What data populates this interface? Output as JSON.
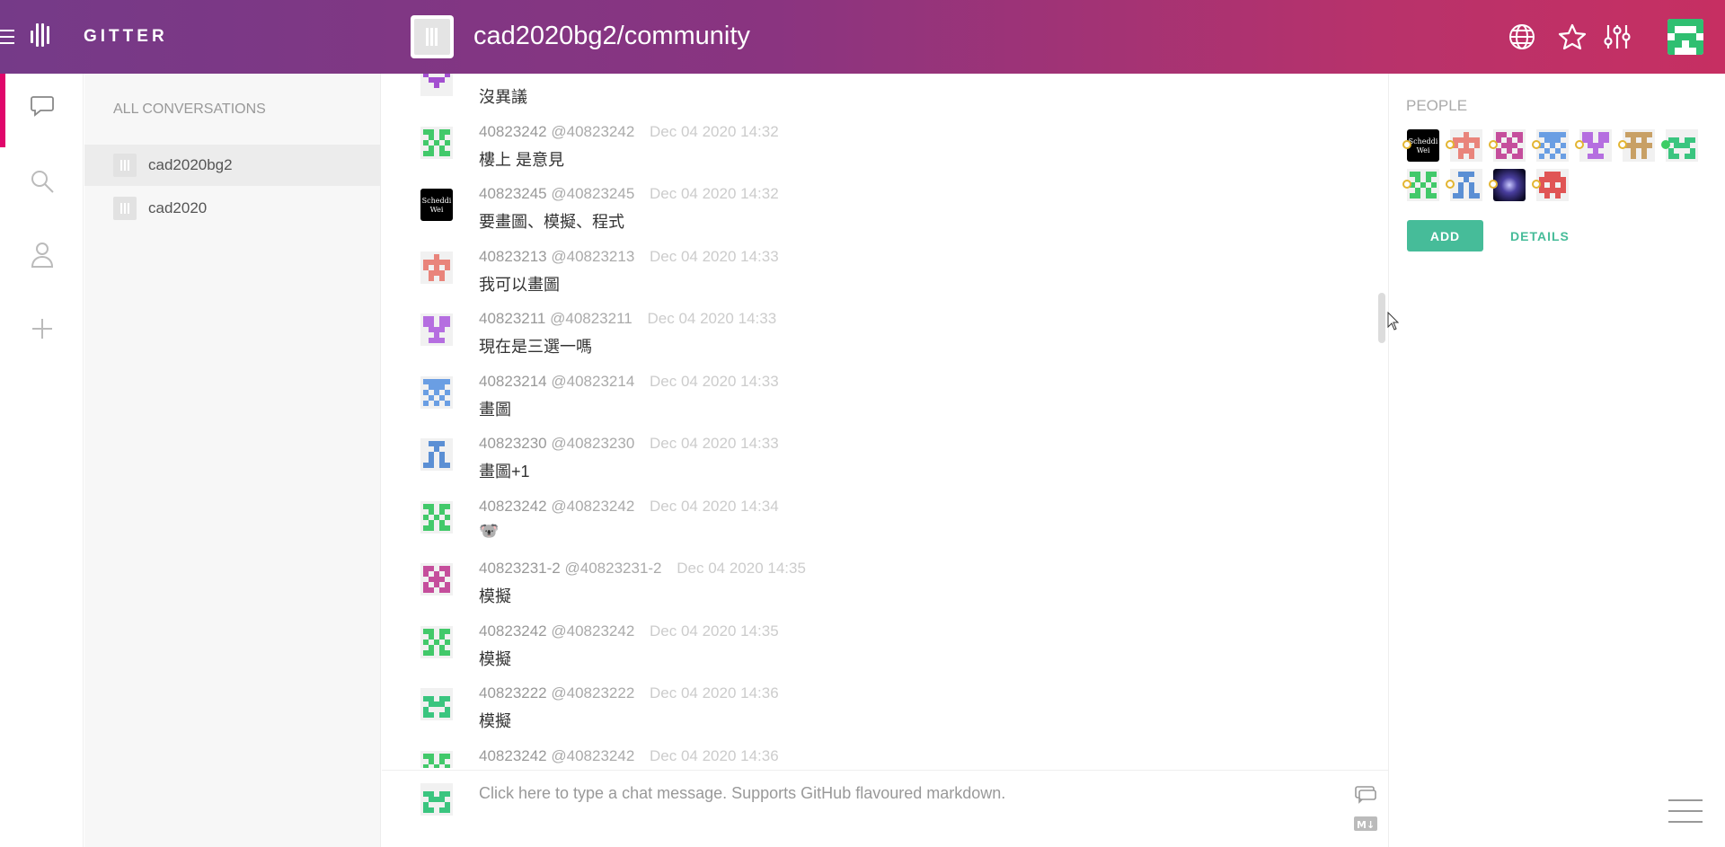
{
  "header": {
    "brand": "GITTER",
    "room_title": "cad2020bg2/community",
    "icons": [
      "globe-icon",
      "star-icon",
      "settings-sliders-icon"
    ]
  },
  "rail": {
    "items": [
      "conversations-icon",
      "search-icon",
      "people-icon",
      "add-icon"
    ]
  },
  "conversations": {
    "title": "ALL CONVERSATIONS",
    "items": [
      {
        "label": "cad2020bg2",
        "active": true
      },
      {
        "label": "cad2020",
        "active": false
      }
    ]
  },
  "messages": [
    {
      "name": "",
      "username": "",
      "time": "",
      "text": "沒異議",
      "avatar": "purple-identicon"
    },
    {
      "name": "40823242",
      "username": "@40823242",
      "time": "Dec 04 2020 14:32",
      "text": "樓上 是意見",
      "avatar": "green-identicon"
    },
    {
      "name": "40823245",
      "username": "@40823245",
      "time": "Dec 04 2020 14:32",
      "text": "要畫圖、模擬、程式",
      "avatar": "scheddi-wei-photo"
    },
    {
      "name": "40823213",
      "username": "@40823213",
      "time": "Dec 04 2020 14:33",
      "text": "我可以畫圖",
      "avatar": "salmon-identicon"
    },
    {
      "name": "40823211",
      "username": "@40823211",
      "time": "Dec 04 2020 14:33",
      "text": "現在是三選一嗎",
      "avatar": "violet-identicon"
    },
    {
      "name": "40823214",
      "username": "@40823214",
      "time": "Dec 04 2020 14:33",
      "text": "畫圖",
      "avatar": "blue-identicon"
    },
    {
      "name": "40823230",
      "username": "@40823230",
      "time": "Dec 04 2020 14:33",
      "text": "畫圖+1",
      "avatar": "steelblue-identicon"
    },
    {
      "name": "40823242",
      "username": "@40823242",
      "time": "Dec 04 2020 14:34",
      "text": "🐨",
      "avatar": "green-identicon"
    },
    {
      "name": "40823231-2",
      "username": "@40823231-2",
      "time": "Dec 04 2020 14:35",
      "text": "模擬",
      "avatar": "magenta-identicon"
    },
    {
      "name": "40823242",
      "username": "@40823242",
      "time": "Dec 04 2020 14:35",
      "text": "模擬",
      "avatar": "green-identicon"
    },
    {
      "name": "40823222",
      "username": "@40823222",
      "time": "Dec 04 2020 14:36",
      "text": "模擬",
      "avatar": "teal-identicon"
    },
    {
      "name": "40823242",
      "username": "@40823242",
      "time": "Dec 04 2020 14:36",
      "text": "",
      "avatar": "green-identicon"
    }
  ],
  "input": {
    "placeholder": "Click here to type a chat message. Supports GitHub flavoured markdown."
  },
  "people": {
    "title": "PEOPLE",
    "add_label": "ADD",
    "details_label": "DETAILS"
  },
  "colors": {
    "accent": "#46bc99",
    "header_start": "#753a88",
    "header_end": "#c62f62",
    "active_marker": "#e0066b"
  }
}
